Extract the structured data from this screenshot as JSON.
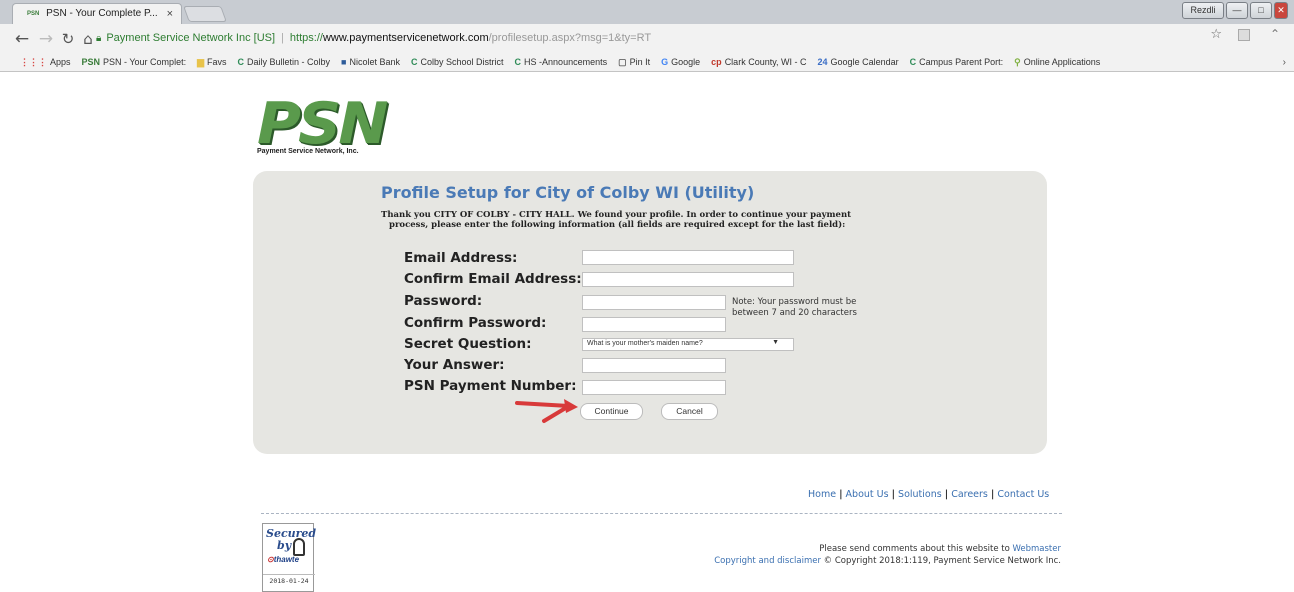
{
  "browser": {
    "tab_title": "PSN - Your Complete P...",
    "tab_favicon": "PSN",
    "window_controls": [
      "Rezdli",
      "—",
      "□",
      "✕"
    ],
    "address": {
      "secure_label": "Payment Service Network Inc [US]",
      "url_scheme": "https://",
      "url_host": "www.paymentservicenetwork.com",
      "url_path": "/profilesetup.aspx?msg=1&ty=RT"
    },
    "bookmarks": [
      {
        "icon": "⋮⋮⋮",
        "label": "Apps",
        "color": "#d64541"
      },
      {
        "icon": "PSN",
        "label": "PSN - Your Complet:",
        "color": "#3a7c3a"
      },
      {
        "icon": "▆",
        "label": "Favs",
        "color": "#e8c34a"
      },
      {
        "icon": "C",
        "label": "Daily Bulletin - Colby",
        "color": "#2e8b57"
      },
      {
        "icon": "■",
        "label": "Nicolet Bank",
        "color": "#2e5c9a"
      },
      {
        "icon": "C",
        "label": "Colby School District",
        "color": "#2e8b57"
      },
      {
        "icon": "C",
        "label": "HS -Announcements",
        "color": "#2e8b57"
      },
      {
        "icon": "▢",
        "label": "Pin It",
        "color": "#666666"
      },
      {
        "icon": "G",
        "label": "Google",
        "color": "#4285f4"
      },
      {
        "icon": "cp",
        "label": "Clark County, WI - C",
        "color": "#c0392b"
      },
      {
        "icon": "24",
        "label": "Google Calendar",
        "color": "#3b6ec6"
      },
      {
        "icon": "C",
        "label": "Campus Parent Port:",
        "color": "#2e8b57"
      },
      {
        "icon": "⚲",
        "label": "Online Applications",
        "color": "#7fb040"
      }
    ]
  },
  "logo": {
    "mark": "PSN",
    "tagline": "Payment Service Network, Inc."
  },
  "profile": {
    "title": "Profile Setup for City of Colby WI (Utility)",
    "desc_line1": "Thank you CITY OF COLBY - CITY HALL. We found your profile. In order to continue your payment",
    "desc_line2": "process, please enter the following information (all fields are required except for the last field):",
    "labels": {
      "email": "Email Address:",
      "confirm_email": "Confirm Email Address:",
      "password": "Password:",
      "confirm_password": "Confirm Password:",
      "secret_question": "Secret Question:",
      "answer": "Your Answer:",
      "payment_number": "PSN Payment Number:"
    },
    "values": {
      "email": "",
      "confirm_email": "",
      "password": "",
      "confirm_password": "",
      "answer": "",
      "payment_number": ""
    },
    "secret_question_selected": "What is your mother's maiden name?",
    "password_note_line1": "Note: Your password must be",
    "password_note_line2": "between 7 and 20 characters",
    "continue_label": "Continue",
    "cancel_label": "Cancel",
    "arrow_color": "#d83a3a"
  },
  "footer": {
    "nav": [
      "Home",
      "About Us",
      "Solutions",
      "Careers",
      "Contact Us"
    ],
    "comments_text": "Please send comments about this website to",
    "webmaster": "Webmaster",
    "copyright_link": "Copyright and disclaimer",
    "copyright_text": "© Copyright 2018:1:119, Payment Service Network Inc.",
    "seal": {
      "line1": "Secured",
      "line2": "by",
      "brand": "thawte",
      "date": "2018-01-24"
    }
  }
}
